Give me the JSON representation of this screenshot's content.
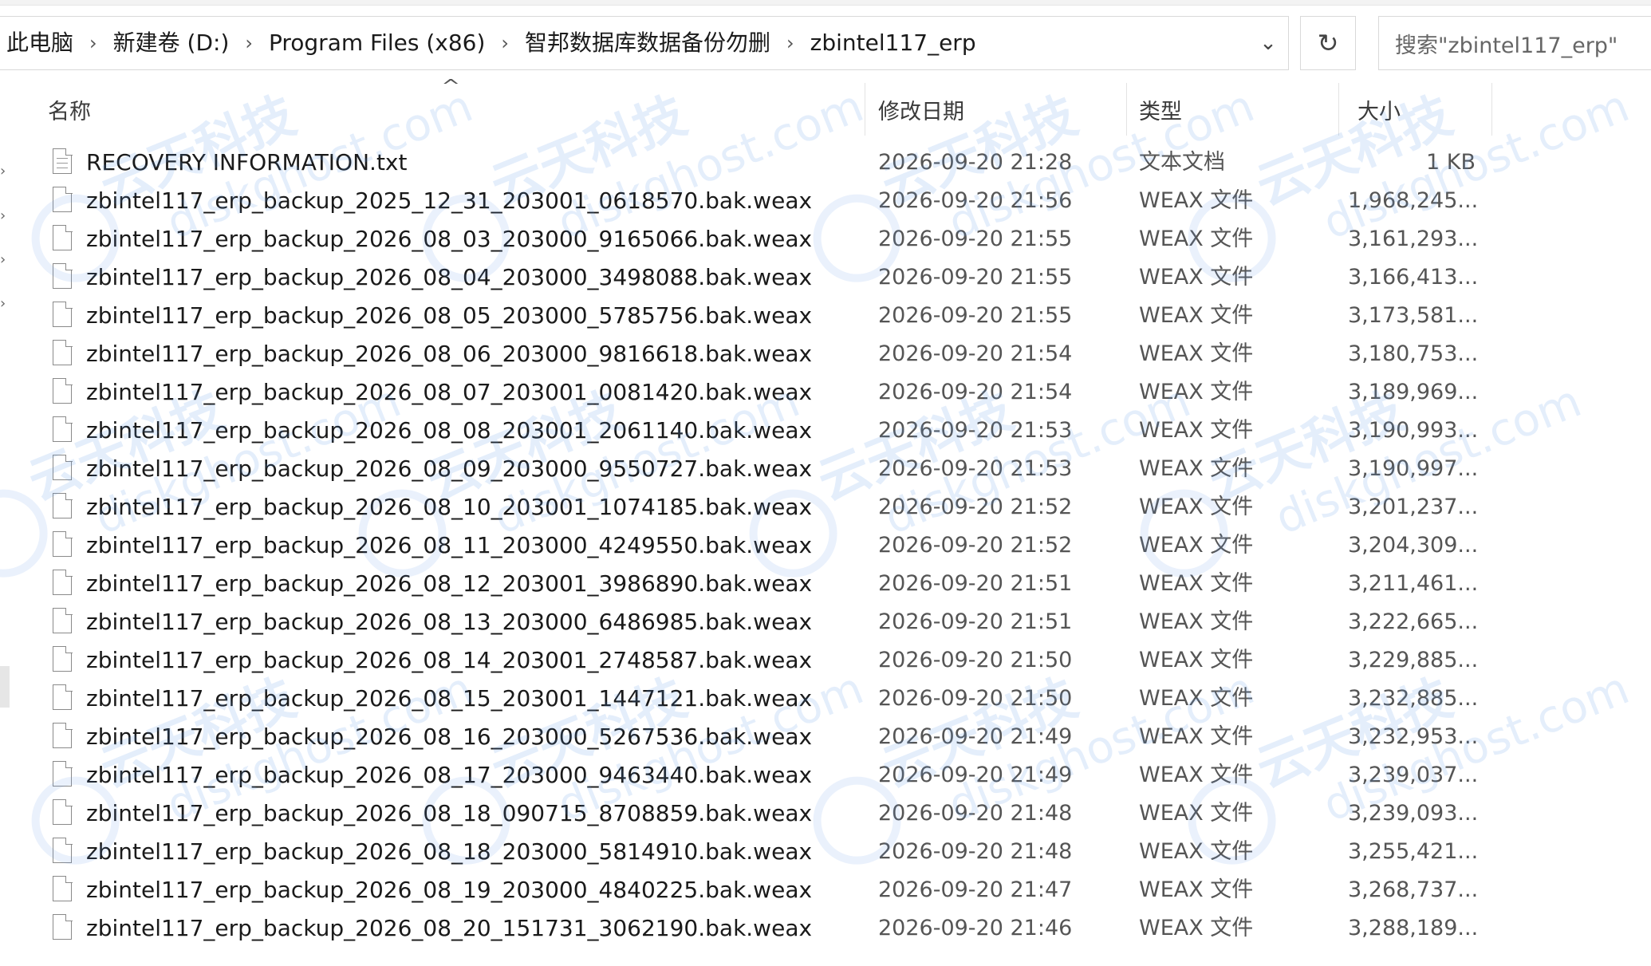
{
  "breadcrumb": [
    "此电脑",
    "新建卷 (D:)",
    "Program Files (x86)",
    "智邦数据库数据备份勿删",
    "zbintel117_erp"
  ],
  "search": {
    "placeholder": "搜索\"zbintel117_erp\""
  },
  "columns": {
    "name": "名称",
    "date": "修改日期",
    "type": "类型",
    "size": "大小"
  },
  "sort": {
    "column": "name",
    "direction": "ascending"
  },
  "files": [
    {
      "name": "RECOVERY INFORMATION.txt",
      "date": "2026-09-20 21:28",
      "type": "文本文档",
      "size": "1 KB",
      "icon": "text-file-icon"
    },
    {
      "name": "zbintel117_erp_backup_2025_12_31_203001_0618570.bak.weax",
      "date": "2026-09-20 21:56",
      "type": "WEAX 文件",
      "size": "1,968,245...",
      "icon": "file-icon"
    },
    {
      "name": "zbintel117_erp_backup_2026_08_03_203000_9165066.bak.weax",
      "date": "2026-09-20 21:55",
      "type": "WEAX 文件",
      "size": "3,161,293...",
      "icon": "file-icon"
    },
    {
      "name": "zbintel117_erp_backup_2026_08_04_203000_3498088.bak.weax",
      "date": "2026-09-20 21:55",
      "type": "WEAX 文件",
      "size": "3,166,413...",
      "icon": "file-icon"
    },
    {
      "name": "zbintel117_erp_backup_2026_08_05_203000_5785756.bak.weax",
      "date": "2026-09-20 21:55",
      "type": "WEAX 文件",
      "size": "3,173,581...",
      "icon": "file-icon"
    },
    {
      "name": "zbintel117_erp_backup_2026_08_06_203000_9816618.bak.weax",
      "date": "2026-09-20 21:54",
      "type": "WEAX 文件",
      "size": "3,180,753...",
      "icon": "file-icon"
    },
    {
      "name": "zbintel117_erp_backup_2026_08_07_203001_0081420.bak.weax",
      "date": "2026-09-20 21:54",
      "type": "WEAX 文件",
      "size": "3,189,969...",
      "icon": "file-icon"
    },
    {
      "name": "zbintel117_erp_backup_2026_08_08_203001_2061140.bak.weax",
      "date": "2026-09-20 21:53",
      "type": "WEAX 文件",
      "size": "3,190,993...",
      "icon": "file-icon"
    },
    {
      "name": "zbintel117_erp_backup_2026_08_09_203000_9550727.bak.weax",
      "date": "2026-09-20 21:53",
      "type": "WEAX 文件",
      "size": "3,190,997...",
      "icon": "file-icon"
    },
    {
      "name": "zbintel117_erp_backup_2026_08_10_203001_1074185.bak.weax",
      "date": "2026-09-20 21:52",
      "type": "WEAX 文件",
      "size": "3,201,237...",
      "icon": "file-icon"
    },
    {
      "name": "zbintel117_erp_backup_2026_08_11_203000_4249550.bak.weax",
      "date": "2026-09-20 21:52",
      "type": "WEAX 文件",
      "size": "3,204,309...",
      "icon": "file-icon"
    },
    {
      "name": "zbintel117_erp_backup_2026_08_12_203001_3986890.bak.weax",
      "date": "2026-09-20 21:51",
      "type": "WEAX 文件",
      "size": "3,211,461...",
      "icon": "file-icon"
    },
    {
      "name": "zbintel117_erp_backup_2026_08_13_203000_6486985.bak.weax",
      "date": "2026-09-20 21:51",
      "type": "WEAX 文件",
      "size": "3,222,665...",
      "icon": "file-icon"
    },
    {
      "name": "zbintel117_erp_backup_2026_08_14_203001_2748587.bak.weax",
      "date": "2026-09-20 21:50",
      "type": "WEAX 文件",
      "size": "3,229,885...",
      "icon": "file-icon"
    },
    {
      "name": "zbintel117_erp_backup_2026_08_15_203001_1447121.bak.weax",
      "date": "2026-09-20 21:50",
      "type": "WEAX 文件",
      "size": "3,232,885...",
      "icon": "file-icon"
    },
    {
      "name": "zbintel117_erp_backup_2026_08_16_203000_5267536.bak.weax",
      "date": "2026-09-20 21:49",
      "type": "WEAX 文件",
      "size": "3,232,953...",
      "icon": "file-icon"
    },
    {
      "name": "zbintel117_erp_backup_2026_08_17_203000_9463440.bak.weax",
      "date": "2026-09-20 21:49",
      "type": "WEAX 文件",
      "size": "3,239,037...",
      "icon": "file-icon"
    },
    {
      "name": "zbintel117_erp_backup_2026_08_18_090715_8708859.bak.weax",
      "date": "2026-09-20 21:48",
      "type": "WEAX 文件",
      "size": "3,239,093...",
      "icon": "file-icon"
    },
    {
      "name": "zbintel117_erp_backup_2026_08_18_203000_5814910.bak.weax",
      "date": "2026-09-20 21:48",
      "type": "WEAX 文件",
      "size": "3,255,421...",
      "icon": "file-icon"
    },
    {
      "name": "zbintel117_erp_backup_2026_08_19_203000_4840225.bak.weax",
      "date": "2026-09-20 21:47",
      "type": "WEAX 文件",
      "size": "3,268,737...",
      "icon": "file-icon"
    },
    {
      "name": "zbintel117_erp_backup_2026_08_20_151731_3062190.bak.weax",
      "date": "2026-09-20 21:46",
      "type": "WEAX 文件",
      "size": "3,288,189...",
      "icon": "file-icon"
    }
  ],
  "watermark": {
    "cn": "云天科技",
    "en": "diskghost.com",
    "color": "#5a96e6"
  },
  "colors": {
    "text": "#1a1a1a",
    "muted": "#555555",
    "border": "#d9d9d9"
  }
}
